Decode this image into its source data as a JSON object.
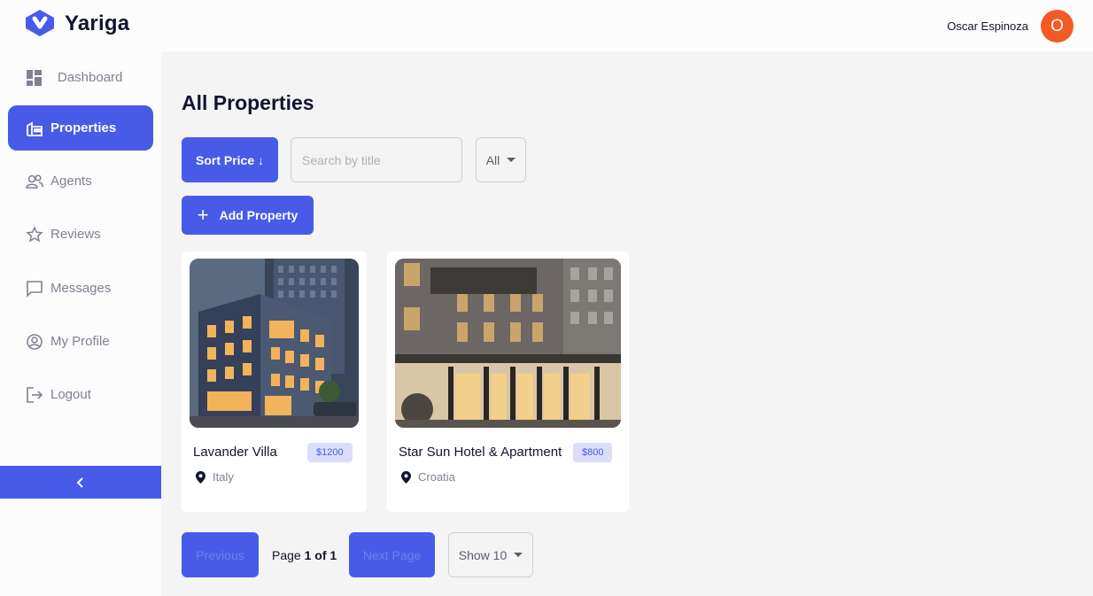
{
  "app": {
    "name": "Yariga"
  },
  "user": {
    "name": "Oscar Espinoza",
    "initial": "O"
  },
  "sidebar": {
    "items": [
      {
        "label": "Dashboard",
        "icon": "dashboard-icon"
      },
      {
        "label": "Properties",
        "icon": "properties-icon",
        "active": true
      },
      {
        "label": "Agents",
        "icon": "agents-icon"
      },
      {
        "label": "Reviews",
        "icon": "star-icon"
      },
      {
        "label": "Messages",
        "icon": "message-icon"
      },
      {
        "label": "My Profile",
        "icon": "profile-icon"
      },
      {
        "label": "Logout",
        "icon": "logout-icon"
      }
    ],
    "collapse_icon": "chevron-left-icon"
  },
  "page": {
    "title": "All Properties"
  },
  "toolbar": {
    "sort_label": "Sort Price ↓",
    "search_placeholder": "Search by title",
    "search_value": "",
    "filter_value": "All",
    "add_label": "Add Property"
  },
  "properties": [
    {
      "title": "Lavander Villa",
      "price": "$1200",
      "location": "Italy"
    },
    {
      "title": "Star Sun Hotel & Apartment",
      "price": "$800",
      "location": "Croatia"
    }
  ],
  "pagination": {
    "previous_label": "Previous",
    "next_label": "Next Page",
    "page_prefix": "Page",
    "page_current": "1 of 1",
    "show_label": "Show 10"
  },
  "colors": {
    "primary": "#475be8",
    "avatar": "#f45a24",
    "price_bg": "#dadefa"
  }
}
